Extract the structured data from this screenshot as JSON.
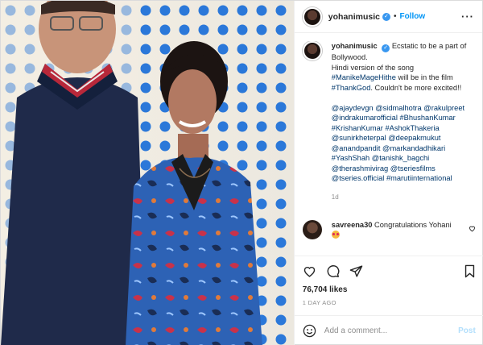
{
  "post": {
    "username": "yohanimusic",
    "follow_label": "Follow",
    "caption": {
      "username": "yohanimusic",
      "text_1": "Ecstatic to be a part of Bollywood.",
      "text_2": "Hindi version of the song",
      "hashtag_song": "#ManikeMageHithe",
      "text_3": "will be in the film",
      "hashtag_film": "#ThankGod",
      "text_4": ". Couldn't be more excited!!",
      "tags": [
        "@ajaydevgn",
        "@sidmalhotra",
        "@rakulpreet",
        "@indrakumarofficial",
        "#BhushanKumar",
        "#KrishanKumar",
        "#AshokThakeria",
        "@sunirkheterpal",
        "@deepakmukut",
        "@anandpandit",
        "@markandadhikari",
        "#YashShah",
        "@tanishk_bagchi",
        "@therashmivirag",
        "@tseriesfilms",
        "@tseries.official",
        "#marutiinternational"
      ],
      "age": "1d"
    },
    "reply": {
      "username": "savreena30",
      "text": "Congratulations Yohani"
    },
    "likes": "76,704 likes",
    "posted": "1 DAY AGO",
    "comment_placeholder": "Add a comment...",
    "post_button": "Post"
  },
  "colors": {
    "link_blue": "#0095f6",
    "tag_blue": "#00376b",
    "muted": "#8e8e8e",
    "verified": "#3897f0"
  },
  "icons": [
    "more-options-icon",
    "heart-icon",
    "comment-icon",
    "share-icon",
    "save-icon",
    "emoji-icon",
    "verified-badge-icon"
  ]
}
